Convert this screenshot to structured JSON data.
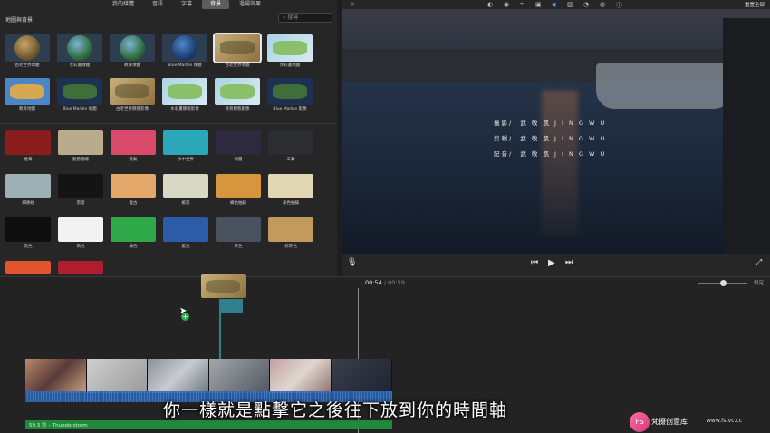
{
  "tabs": [
    "我的媒體",
    "音訊",
    "字幕",
    "背景",
    "過場效果"
  ],
  "active_tab_index": 3,
  "browser": {
    "section_title": "地圖與背景",
    "search_placeholder": "搜尋",
    "map_items": [
      {
        "label": "古老世界球體",
        "style": "globe-brown"
      },
      {
        "label": "水彩畫球體",
        "style": "globe"
      },
      {
        "label": "教育球體",
        "style": "globe"
      },
      {
        "label": "Blue Marble 球體",
        "style": "globe-sat"
      },
      {
        "label": "古老世界地圖",
        "style": "oldmap",
        "selected": true
      },
      {
        "label": "水彩畫地圖",
        "style": "colormap"
      },
      {
        "label": "教育地圖",
        "style": "eduflat"
      },
      {
        "label": "Blue Marble 地圖",
        "style": "bmmap"
      },
      {
        "label": "古老世界靜態影像",
        "style": "oldmap"
      },
      {
        "label": "水彩畫靜態影像",
        "style": "colormap"
      },
      {
        "label": "教育靜態影像",
        "style": "colormap"
      },
      {
        "label": "Blue Marble 影像",
        "style": "bmmap"
      }
    ],
    "background_items": [
      {
        "label": "帷幕",
        "color": "#8a1c1c"
      },
      {
        "label": "動態圖樣",
        "color": "#b9ab8c"
      },
      {
        "label": "蒸氣",
        "color": "#d94a6a"
      },
      {
        "label": "水中世界",
        "color": "#2aa7b8"
      },
      {
        "label": "漸層",
        "color": "#2d2a3f"
      },
      {
        "label": "工業",
        "color": "#2b2d30"
      },
      {
        "label": "細條紋",
        "color": "#9fb0b4"
      },
      {
        "label": "黑暗",
        "color": "#141414"
      },
      {
        "label": "復古",
        "color": "#e2a769"
      },
      {
        "label": "紙張",
        "color": "#d8d9c4"
      },
      {
        "label": "橘色抽鑰",
        "color": "#d7963e"
      },
      {
        "label": "米色抽鑰",
        "color": "#e2d7b4"
      },
      {
        "label": "黑色",
        "color": "#0e0e0e"
      },
      {
        "label": "白色",
        "color": "#f2f2f2"
      },
      {
        "label": "綠色",
        "color": "#2fa84a"
      },
      {
        "label": "藍色",
        "color": "#2c5ba8"
      },
      {
        "label": "灰色",
        "color": "#4a5260"
      },
      {
        "label": "棕灰色",
        "color": "#c29a5e"
      },
      {
        "label": "",
        "color": "#e2542e"
      },
      {
        "label": "",
        "color": "#b01d2e"
      }
    ]
  },
  "viewer": {
    "reset_label": "重置全部",
    "credits": [
      {
        "role": "攝影/",
        "name": "武 敬 凱 J I N G W U"
      },
      {
        "role": "剪輯/",
        "name": "武 敬 凱 J I N G W U"
      },
      {
        "role": "配音/",
        "name": "武 敬 凱 J I N G W U"
      }
    ]
  },
  "timeline": {
    "current_time": "00:54",
    "separator": "/",
    "total_time": "00:59",
    "zoom_label": "設定",
    "music_label": "59.3 秒 – Thunderstorm"
  },
  "subtitle": "你一樣就是點擊它之後往下放到你的時間軸",
  "watermark": {
    "logo": "FS",
    "name": "梵摄创意库",
    "url": "www.fstvc.cc"
  }
}
